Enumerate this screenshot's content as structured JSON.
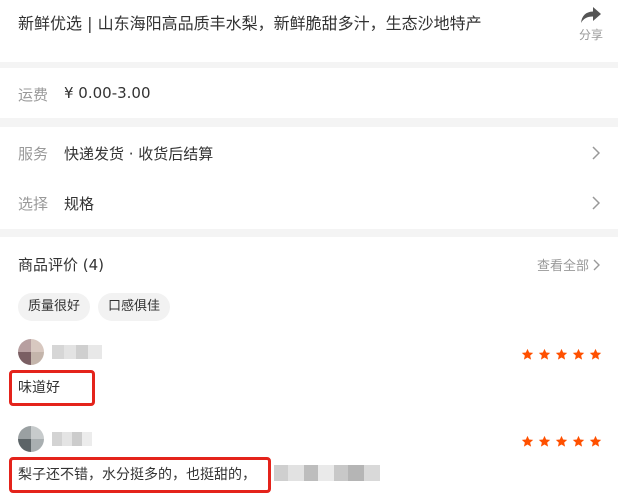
{
  "product": {
    "title": "新鲜优选 | 山东海阳高品质丰水梨，新鲜脆甜多汁，生态沙地特产",
    "share_label": "分享"
  },
  "shipping": {
    "label": "运费",
    "value": "¥ 0.00-3.00"
  },
  "service": {
    "label": "服务",
    "value": "快递发货 · 收货后结算"
  },
  "select": {
    "label": "选择",
    "value": "规格"
  },
  "reviews": {
    "title": "商品评价 (4)",
    "see_all": "查看全部",
    "tags": [
      "质量很好",
      "口感俱佳"
    ],
    "items": [
      {
        "rating": 5,
        "text": "味道好"
      },
      {
        "rating": 5,
        "text": "梨子还不错，水分挺多的，也挺甜的，"
      }
    ]
  },
  "colors": {
    "star": "#ff5000",
    "highlight": "#e4231b"
  },
  "icons": {
    "share": "share-arrow-icon",
    "chevron": "chevron-right-icon",
    "star": "star-icon"
  }
}
